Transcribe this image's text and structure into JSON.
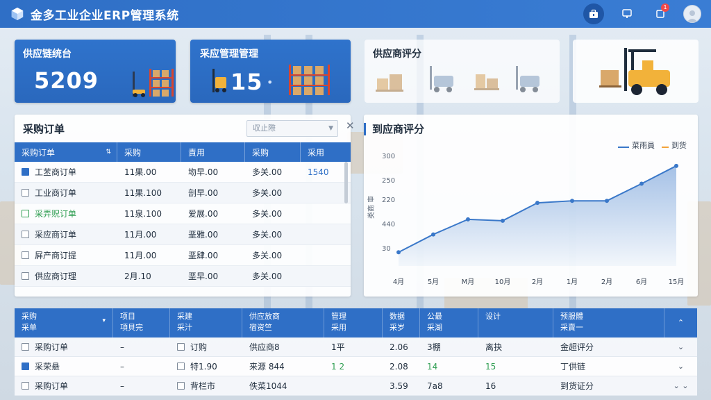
{
  "app": {
    "title": "金多工业企业ERP管理系统"
  },
  "topbar": {
    "notification_count": "1"
  },
  "stats": [
    {
      "title": "供应链统台",
      "value": "5209"
    },
    {
      "title": "采应管理管理",
      "value": "15"
    },
    {
      "title": "供应商评分"
    }
  ],
  "orders": {
    "title": "采购订单",
    "filter_placeholder": "収止際",
    "columns": [
      "采购订单",
      "采购",
      "責用",
      "采购",
      "采用"
    ],
    "rows": [
      {
        "name": "工苤商订单",
        "c1": "11果.00",
        "c2": "圽早.00",
        "c3": "多关.00",
        "c4": "1540",
        "checked": true,
        "style": ""
      },
      {
        "name": "工业商订单",
        "c1": "11果.100",
        "c2": "剖早.00",
        "c3": "多关.00",
        "c4": "",
        "checked": false,
        "style": ""
      },
      {
        "name": "采弄贶订单",
        "c1": "11泉.100",
        "c2": "爱展.00",
        "c3": "多关.00",
        "c4": "",
        "checked": false,
        "style": "green"
      },
      {
        "name": "采应商订单",
        "c1": "11月.00",
        "c2": "垩雅.00",
        "c3": "多关.00",
        "c4": "",
        "checked": false,
        "style": ""
      },
      {
        "name": "屛产商订提",
        "c1": "11月.00",
        "c2": "垩肆.00",
        "c3": "多关.00",
        "c4": "",
        "checked": false,
        "style": ""
      },
      {
        "name": "供应商订理",
        "c1": "2月.10",
        "c2": "垩早.00",
        "c3": "多关.00",
        "c4": "",
        "checked": false,
        "style": ""
      }
    ]
  },
  "chart_panel": {
    "title": "到应商评分"
  },
  "chart_data": {
    "type": "area",
    "title": "到应商评分",
    "ylabel": "类商 审",
    "categories": [
      "4月",
      "5月",
      "M月",
      "10月",
      "2月",
      "1月",
      "2月",
      "6月",
      "15月"
    ],
    "y_ticks": [
      "30",
      "440",
      "220",
      "250",
      "300"
    ],
    "series": [
      {
        "name": "菜雨員",
        "values": [
          1,
          2.3,
          3.4,
          3.3,
          4.6,
          4.75,
          4.75,
          6.0,
          7.3
        ]
      }
    ],
    "legend": [
      "菜雨員",
      "到货"
    ],
    "legend_position": "top-right",
    "grid": false,
    "color": "#3a78c9"
  },
  "bottom": {
    "columns": [
      [
        "采购",
        "采单"
      ],
      [
        "项目",
        "項貝完"
      ],
      [
        "采建",
        "采汁"
      ],
      [
        "供应放商",
        "宿资竺"
      ],
      [
        "管理",
        "采用"
      ],
      [
        "数据",
        "采岁"
      ],
      [
        "公最",
        "采湖"
      ],
      [
        "",
        "设计"
      ],
      [
        "预服體",
        "采賣一"
      ]
    ],
    "rows": [
      {
        "c0": "采购订单",
        "c1": "–",
        "c2": "订购",
        "c3": "供应商8",
        "c4": "1平",
        "c5": "2.06",
        "c6": "3棚",
        "c7": "离抉",
        "c8": "金超评分",
        "style": ""
      },
      {
        "c0": "采荣悬",
        "c1": "–",
        "c2": "特1.90",
        "c3": "来源 844",
        "c4": "1 2",
        "c5": "2.08",
        "c6": "14",
        "c7": "15",
        "c8": "丁供链",
        "style": "green"
      },
      {
        "c0": "采购订单",
        "c1": "–",
        "c2": "背栏市",
        "c3": "佚菜1044",
        "c4": "",
        "c5": "3.59",
        "c6": "7a8",
        "c7": "16",
        "c8": "到货证分",
        "style": ""
      }
    ]
  }
}
